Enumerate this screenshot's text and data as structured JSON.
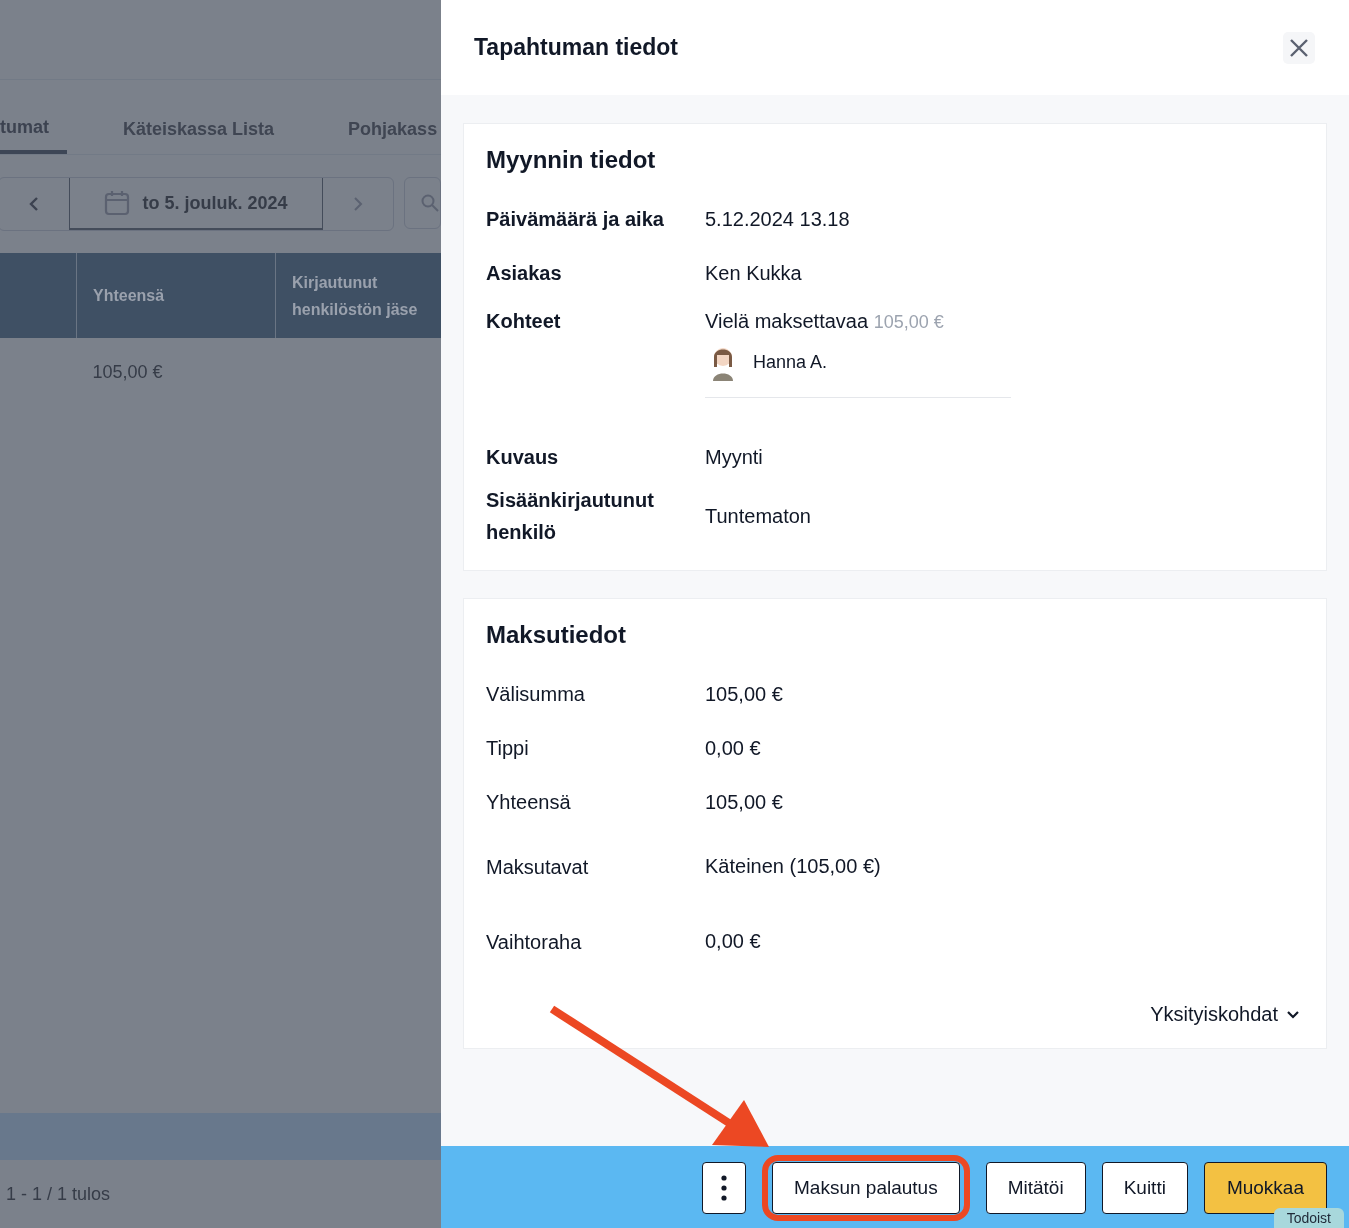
{
  "background_page": {
    "tabs": [
      {
        "label": "tumat",
        "selected": true
      },
      {
        "label": "Käteiskassa Lista",
        "selected": false
      },
      {
        "label": "Pohjakass",
        "selected": false
      }
    ],
    "date_picker": {
      "value": "to 5. jouluk. 2024"
    },
    "table": {
      "columns": [
        "Yhteensä",
        "Kirjautunut henkilöstön jäse"
      ],
      "rows": [
        [
          "105,00 €"
        ]
      ]
    },
    "pagination": "1 - 1 / 1 tulos"
  },
  "drawer": {
    "title": "Tapahtuman tiedot",
    "sections": [
      {
        "title": "Myynnin tiedot",
        "bold_labels": true,
        "fields": [
          {
            "kind": "text",
            "label": "Päivämäärä ja aika",
            "value": "5.12.2024 13.18"
          },
          {
            "kind": "text",
            "label": "Asiakas",
            "value": "Ken Kukka"
          },
          {
            "kind": "items",
            "label": "Kohteet",
            "value": "Vielä maksettavaa",
            "amount": "105,00 €",
            "staff": "Hanna A."
          },
          {
            "kind": "text",
            "label": "Kuvaus",
            "value": "Myynti"
          },
          {
            "kind": "text",
            "label": "Sisäänkirjautunut henkilö",
            "value": "Tuntematon"
          }
        ]
      },
      {
        "title": "Maksutiedot",
        "bold_labels": false,
        "fields": [
          {
            "kind": "text",
            "label": "Välisumma",
            "value": "105,00 €"
          },
          {
            "kind": "text",
            "label": "Tippi",
            "value": "0,00 €"
          },
          {
            "kind": "text",
            "label": "Yhteensä",
            "value": "105,00 €"
          },
          {
            "kind": "spaced",
            "label": "Maksutavat",
            "value": "Käteinen (105,00 €)"
          },
          {
            "kind": "spaced",
            "label": "Vaihtoraha",
            "value": "0,00 €"
          }
        ],
        "details_toggle": "Yksityiskohdat"
      }
    ],
    "footer_buttons": [
      {
        "kind": "more",
        "highlighted": false
      },
      {
        "kind": "plain",
        "label": "Maksun palautus",
        "highlighted": true
      },
      {
        "kind": "plain",
        "label": "Mitätöi",
        "highlighted": false
      },
      {
        "kind": "plain",
        "label": "Kuitti",
        "highlighted": false
      },
      {
        "kind": "primary",
        "label": "Muokkaa",
        "highlighted": false
      }
    ]
  },
  "badge": "Todoist"
}
